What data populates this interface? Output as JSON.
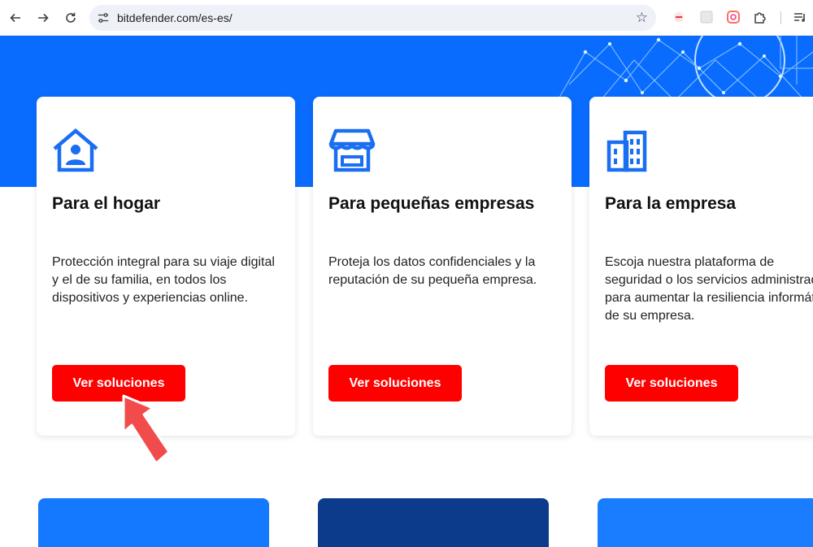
{
  "browser": {
    "url": "bitdefender.com/es-es/",
    "icons": {
      "back": "arrow-left-icon",
      "forward": "arrow-right-icon",
      "reload": "reload-icon",
      "site_settings": "tune-icon",
      "bookmark": "star-outline-icon",
      "extensions": "puzzle-icon",
      "media": "media-queue-icon"
    }
  },
  "colors": {
    "brand_blue": "#0a6cff",
    "button_red": "#ff0000",
    "icon_blue": "#1a6ef2",
    "arrow_red": "#f24b4b"
  },
  "cards": [
    {
      "icon": "house-person-icon",
      "title": "Para el hogar",
      "description": "Protección integral para su viaje digital y el de su familia, en todos los dispositivos y experiencias online.",
      "button": "Ver soluciones"
    },
    {
      "icon": "storefront-icon",
      "title": "Para pequeñas empresas",
      "description": "Proteja los datos confidenciales y la reputación de su pequeña empresa.",
      "button": "Ver soluciones"
    },
    {
      "icon": "office-buildings-icon",
      "title": "Para la empresa",
      "description": "Escoja nuestra plataforma de seguridad o los servicios administrados para aumentar la resiliencia informática de su empresa.",
      "button": "Ver soluciones"
    }
  ],
  "annotation": {
    "icon": "pointer-arrow-icon"
  }
}
